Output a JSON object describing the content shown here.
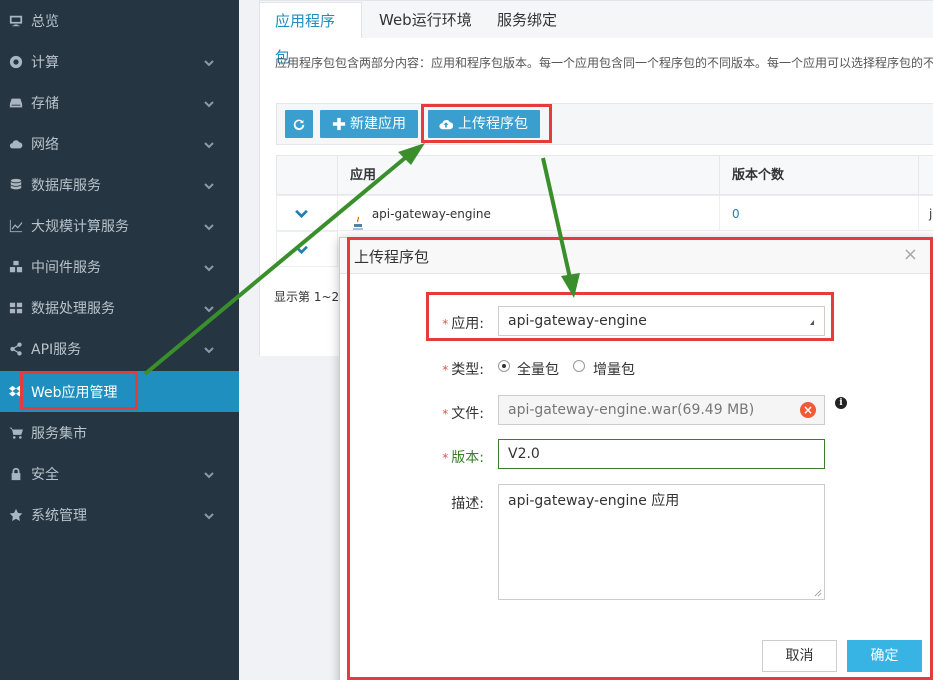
{
  "sidebar": {
    "items": [
      {
        "label": "总览",
        "icon": "monitor-icon",
        "chevron": false
      },
      {
        "label": "计算",
        "icon": "compute-icon",
        "chevron": true
      },
      {
        "label": "存储",
        "icon": "storage-icon",
        "chevron": true
      },
      {
        "label": "网络",
        "icon": "cloud-icon",
        "chevron": true
      },
      {
        "label": "数据库服务",
        "icon": "database-icon",
        "chevron": true
      },
      {
        "label": "大规模计算服务",
        "icon": "chart-icon",
        "chevron": true
      },
      {
        "label": "中间件服务",
        "icon": "cubes-icon",
        "chevron": true
      },
      {
        "label": "数据处理服务",
        "icon": "grid-icon",
        "chevron": true
      },
      {
        "label": "API服务",
        "icon": "share-icon",
        "chevron": true
      },
      {
        "label": "Web应用管理",
        "icon": "dropbox-icon",
        "chevron": false,
        "active": true
      },
      {
        "label": "服务集市",
        "icon": "cart-icon",
        "chevron": false
      },
      {
        "label": "安全",
        "icon": "lock-icon",
        "chevron": true
      },
      {
        "label": "系统管理",
        "icon": "star-icon",
        "chevron": true
      }
    ]
  },
  "tabs": [
    "应用程序包",
    "Web运行环境",
    "服务绑定"
  ],
  "description": "应用程序包包含两部分内容：应用和程序包版本。每一个应用包含同一个程序包的不同版本。每一个应用可以选择程序包的不同",
  "toolbar": {
    "new_app": "新建应用",
    "upload": "上传程序包"
  },
  "table": {
    "headers": [
      "应用",
      "版本个数"
    ],
    "rows": [
      {
        "name": "api-gateway-engine",
        "versions": "0",
        "extra": "j"
      }
    ],
    "footer": "显示第 1~2"
  },
  "dialog": {
    "title": "上传程序包",
    "close": "×",
    "app_label": "应用:",
    "app_value": "api-gateway-engine",
    "type_label": "类型:",
    "type_full": "全量包",
    "type_incremental": "增量包",
    "file_label": "文件:",
    "file_value": "api-gateway-engine.war(69.49 MB)",
    "version_label": "版本:",
    "version_value": "V2.0",
    "desc_label": "描述:",
    "desc_value": "api-gateway-engine 应用",
    "cancel": "取消",
    "confirm": "确定"
  },
  "colors": {
    "sidebar_bg": "#253541",
    "accent": "#1f8fbf",
    "highlight": "#e53b3b",
    "arrow": "#3a8f2c"
  }
}
